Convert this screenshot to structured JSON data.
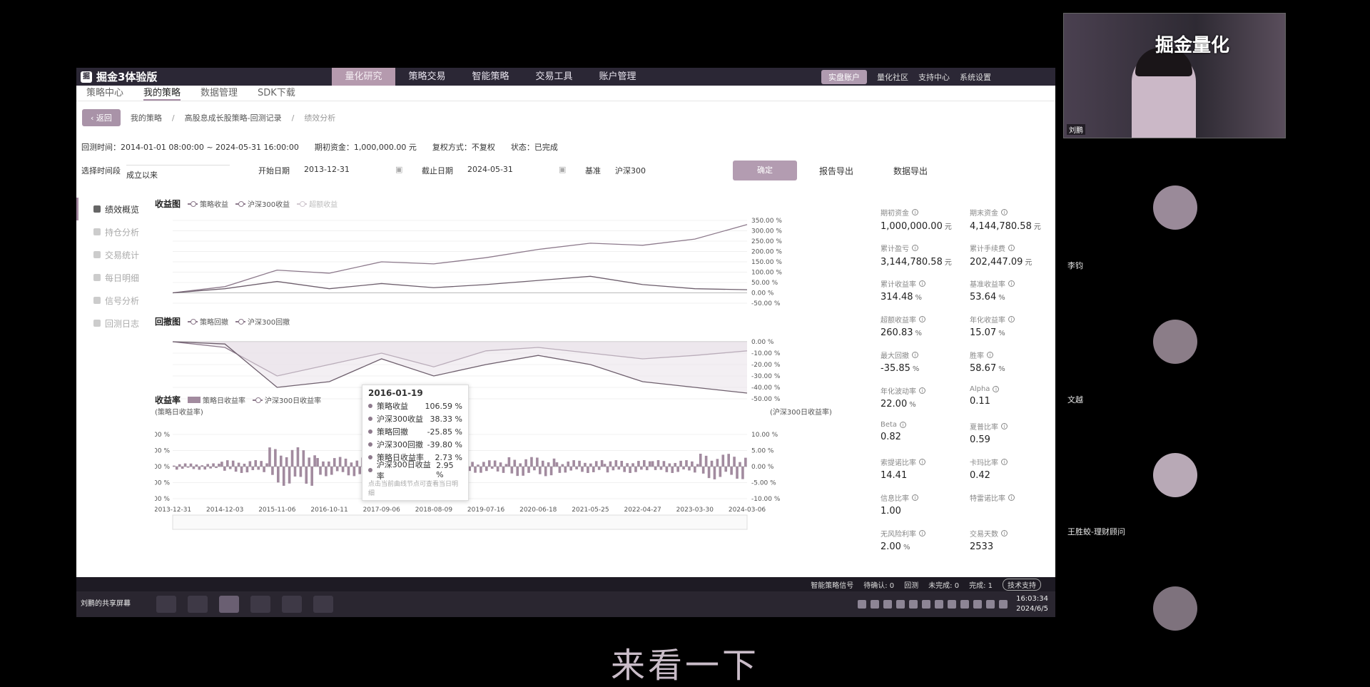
{
  "app": {
    "brand": "掘金3体验版",
    "nav": [
      {
        "label": "量化研究",
        "active": true
      },
      {
        "label": "策略交易",
        "active": false
      },
      {
        "label": "智能策略",
        "active": false
      },
      {
        "label": "交易工具",
        "active": false
      },
      {
        "label": "账户管理",
        "active": false
      }
    ],
    "top_right": {
      "pill": "实盘账户",
      "links": [
        "量化社区",
        "支持中心",
        "系统设置"
      ]
    }
  },
  "subnav": [
    {
      "label": "策略中心",
      "active": false
    },
    {
      "label": "我的策略",
      "active": true
    },
    {
      "label": "数据管理",
      "active": false
    },
    {
      "label": "SDK下载",
      "active": false
    }
  ],
  "breadcrumb": {
    "back": "返回",
    "items": [
      "我的策略",
      "高股息成长股策略-回测记录",
      "绩效分析"
    ]
  },
  "meta": {
    "backtest_time": "回测时间：2014-01-01 08:00:00 ~ 2024-05-31 16:00:00",
    "initial_capital": "期初资金：1,000,000.00 元",
    "rights_mode": "复权方式：不复权",
    "status": "状态：已完成"
  },
  "filters": {
    "period_label": "选择时间段",
    "period_value": "成立以来",
    "start_label": "开始日期",
    "start_value": "2013-12-31",
    "end_label": "截止日期",
    "end_value": "2024-05-31",
    "bench_label": "基准",
    "bench_value": "沪深300",
    "query": "确定",
    "report_export": "报告导出",
    "data_export": "数据导出"
  },
  "side_menu": [
    {
      "label": "绩效概览",
      "active": true
    },
    {
      "label": "持仓分析",
      "active": false
    },
    {
      "label": "交易统计",
      "active": false
    },
    {
      "label": "每日明细",
      "active": false
    },
    {
      "label": "信号分析",
      "active": false
    },
    {
      "label": "回测日志",
      "active": false
    }
  ],
  "charts": {
    "returns_title": "收益图",
    "returns_legend": [
      "策略收益",
      "沪深300收益",
      "超额收益"
    ],
    "drawdown_title": "回撤图",
    "drawdown_legend": [
      "策略回撤",
      "沪深300回撤"
    ],
    "daily_title": "收益率",
    "daily_legend": [
      "策略日收益率",
      "沪深300日收益率"
    ],
    "daily_left_caption": "(策略日收益率)",
    "daily_right_caption": "(沪深300日收益率)"
  },
  "chart_data": [
    {
      "type": "line",
      "title": "收益图",
      "x": [
        "2013-12-31",
        "2014-12-03",
        "2015-11-06",
        "2016-10-11",
        "2017-09-06",
        "2018-08-09",
        "2019-07-16",
        "2020-06-18",
        "2021-05-25",
        "2022-04-27",
        "2023-03-30",
        "2024-03-06"
      ],
      "series": [
        {
          "name": "策略收益",
          "values": [
            0,
            30,
            110,
            95,
            150,
            140,
            170,
            210,
            240,
            230,
            260,
            330
          ]
        },
        {
          "name": "沪深300收益",
          "values": [
            0,
            20,
            55,
            20,
            45,
            25,
            40,
            60,
            80,
            40,
            20,
            15
          ]
        }
      ],
      "ylim": [
        -50,
        350
      ],
      "ytick_labels": [
        "350.00 %",
        "300.00 %",
        "250.00 %",
        "200.00 %",
        "150.00 %",
        "100.00 %",
        "50.00 %",
        "0.00 %",
        "-50.00 %"
      ],
      "legend": "top-left"
    },
    {
      "type": "area",
      "title": "回撤图",
      "x": [
        "2013-12-31",
        "2014-12-03",
        "2015-11-06",
        "2016-10-11",
        "2017-09-06",
        "2018-08-09",
        "2019-07-16",
        "2020-06-18",
        "2021-05-25",
        "2022-04-27",
        "2023-03-30",
        "2024-03-06"
      ],
      "series": [
        {
          "name": "策略回撤",
          "values": [
            0,
            -5,
            -30,
            -20,
            -10,
            -22,
            -8,
            -5,
            -10,
            -15,
            -12,
            -8
          ]
        },
        {
          "name": "沪深300回撤",
          "values": [
            0,
            -2,
            -40,
            -35,
            -15,
            -30,
            -20,
            -12,
            -20,
            -35,
            -40,
            -45
          ]
        }
      ],
      "ylim": [
        -50,
        0
      ],
      "ytick_labels": [
        "0.00 %",
        "-10.00 %",
        "-20.00 %",
        "-30.00 %",
        "-40.00 %",
        "-50.00 %"
      ]
    },
    {
      "type": "bar",
      "title": "收益率",
      "x": [
        "2013-12-31",
        "2014-12-03",
        "2015-11-06",
        "2016-10-11",
        "2017-09-06",
        "2018-08-09",
        "2019-07-16",
        "2020-06-18",
        "2021-05-25",
        "2022-04-27",
        "2023-03-30",
        "2024-03-06"
      ],
      "series": [
        {
          "name": "策略日收益率",
          "values": [
            1,
            2,
            6,
            3,
            2,
            3,
            2,
            3,
            2,
            2,
            2,
            4
          ]
        },
        {
          "name": "沪深300日收益率",
          "values": [
            1,
            2,
            -7,
            -3,
            -1,
            -2,
            -1,
            -2,
            -1,
            -2,
            -1,
            -3
          ]
        }
      ],
      "ylim": [
        -10,
        10
      ],
      "ytick_labels": [
        "10.00 %",
        "5.00 %",
        "0.00 %",
        "-5.00 %",
        "-10.00 %"
      ],
      "xtick_labels": [
        "2013-12-31",
        "2014-12-03",
        "2015-11-06",
        "2016-10-11",
        "2017-09-06",
        "2018-08-09",
        "2019-07-16",
        "2020-06-18",
        "2021-05-25",
        "2022-04-27",
        "2023-03-30",
        "2024-03-06"
      ]
    }
  ],
  "tooltip": {
    "date": "2016-01-19",
    "rows": [
      {
        "label": "策略收益",
        "value": "106.59 %"
      },
      {
        "label": "沪深300收益",
        "value": "38.33 %"
      },
      {
        "label": "策略回撤",
        "value": "-25.85 %"
      },
      {
        "label": "沪深300回撤",
        "value": "-39.80 %"
      },
      {
        "label": "策略日收益率",
        "value": "2.73 %"
      },
      {
        "label": "沪深300日收益率",
        "value": "2.95 %"
      }
    ],
    "hint": "点击当前曲线节点可查看当日明细"
  },
  "stats": [
    {
      "label": "期初资金",
      "value": "1,000,000.00",
      "unit": "元"
    },
    {
      "label": "期末资金",
      "value": "4,144,780.58",
      "unit": "元"
    },
    {
      "label": "累计盈亏",
      "value": "3,144,780.58",
      "unit": "元"
    },
    {
      "label": "累计手续费",
      "value": "202,447.09",
      "unit": "元"
    },
    {
      "label": "累计收益率",
      "value": "314.48",
      "unit": "%"
    },
    {
      "label": "基准收益率",
      "value": "53.64",
      "unit": "%"
    },
    {
      "label": "超额收益率",
      "value": "260.83",
      "unit": "%"
    },
    {
      "label": "年化收益率",
      "value": "15.07",
      "unit": "%"
    },
    {
      "label": "最大回撤",
      "value": "-35.85",
      "unit": "%"
    },
    {
      "label": "胜率",
      "value": "58.67",
      "unit": "%"
    },
    {
      "label": "年化波动率",
      "value": "22.00",
      "unit": "%"
    },
    {
      "label": "Alpha",
      "value": "0.11",
      "unit": ""
    },
    {
      "label": "Beta",
      "value": "0.82",
      "unit": ""
    },
    {
      "label": "夏普比率",
      "value": "0.59",
      "unit": ""
    },
    {
      "label": "索提诺比率",
      "value": "14.41",
      "unit": ""
    },
    {
      "label": "卡玛比率",
      "value": "0.42",
      "unit": ""
    },
    {
      "label": "信息比率",
      "value": "1.00",
      "unit": ""
    },
    {
      "label": "特雷诺比率",
      "value": "",
      "unit": ""
    },
    {
      "label": "无风险利率",
      "value": "2.00",
      "unit": "%"
    },
    {
      "label": "交易天数",
      "value": "2533",
      "unit": ""
    }
  ],
  "status_bar": {
    "signal": "智能策略信号",
    "pending": "待确认: 0",
    "rejected": "回测",
    "unfinished": "未完成: 0",
    "done": "完成: 1",
    "support": "技术支持"
  },
  "taskbar": {
    "share_label": "刘鹏的共享屏幕",
    "time": "16:03:34",
    "date": "2024/6/5"
  },
  "meeting": {
    "watermark": "掘金量化",
    "host_name": "刘鹏",
    "participants": [
      "李钧",
      "文越",
      "王胜蛟-理财顾问"
    ]
  },
  "subtitle": "来看一下"
}
